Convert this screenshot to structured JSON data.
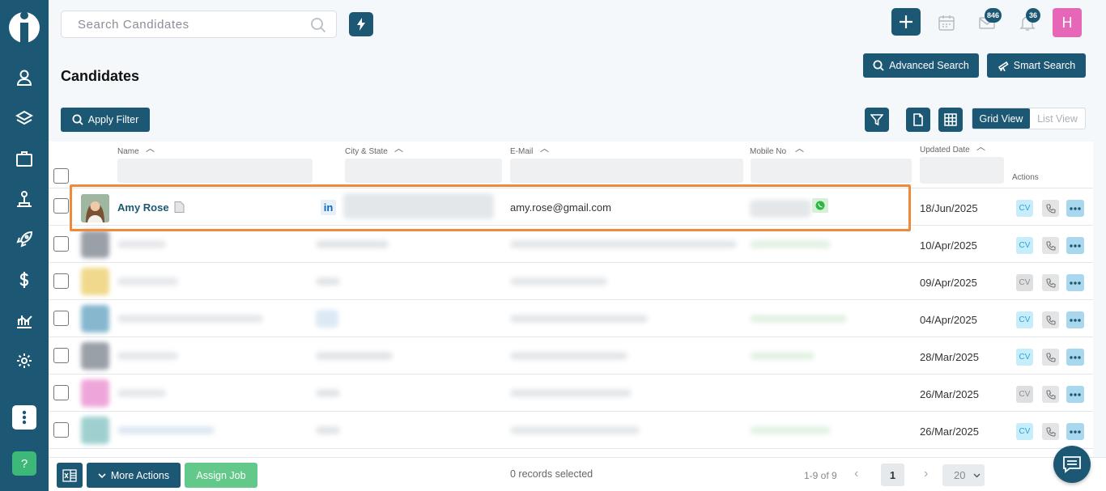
{
  "colors": {
    "primary": "#1c5873",
    "accent_orange": "#ef8a3a",
    "green": "#3cb878",
    "avatar_pink": "#e667b8"
  },
  "topbar": {
    "search_placeholder": "Search Candidates",
    "email_badge": "846",
    "notification_badge": "36",
    "user_initial": "H"
  },
  "page": {
    "title": "Candidates",
    "advanced_search_label": "Advanced Search",
    "smart_search_label": "Smart Search",
    "apply_filter_label": "Apply Filter",
    "grid_view_label": "Grid View",
    "list_view_label": "List View"
  },
  "table": {
    "columns": {
      "name": "Name",
      "city_state": "City & State",
      "email": "E-Mail",
      "mobile": "Mobile No",
      "updated": "Updated Date",
      "actions": "Actions"
    },
    "cv_label": "CV",
    "rows": [
      {
        "name": "Amy Rose",
        "email": "amy.rose@gmail.com",
        "updated": "18/Jun/2025",
        "cv_active": true
      },
      {
        "updated": "10/Apr/2025",
        "cv_active": true
      },
      {
        "updated": "09/Apr/2025",
        "cv_active": false
      },
      {
        "updated": "04/Apr/2025",
        "cv_active": true
      },
      {
        "updated": "28/Mar/2025",
        "cv_active": true
      },
      {
        "updated": "26/Mar/2025",
        "cv_active": false
      },
      {
        "updated": "26/Mar/2025",
        "cv_active": true
      }
    ]
  },
  "footer": {
    "more_actions_label": "More Actions",
    "assign_job_label": "Assign Job",
    "records_selected": "0 records selected",
    "range": "1-9 of 9",
    "current_page": "1",
    "page_size": "20"
  },
  "sidebar": {
    "help_label": "?"
  }
}
